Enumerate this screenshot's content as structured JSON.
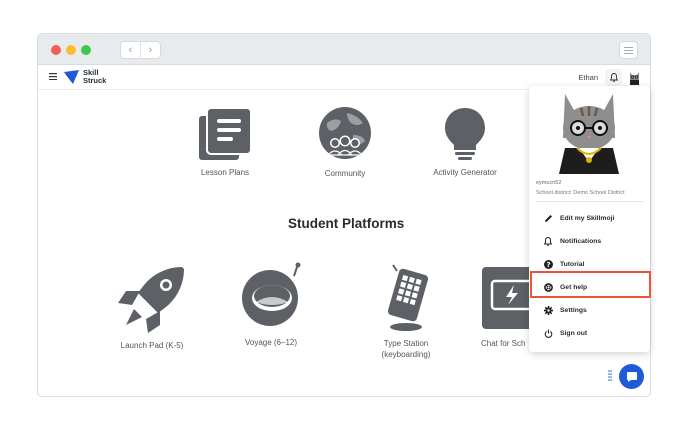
{
  "browser": {
    "back_glyph": "‹",
    "forward_glyph": "›"
  },
  "header": {
    "logo_line1": "Skill",
    "logo_line2": "Struck",
    "username": "Ethan"
  },
  "tiles_top": [
    {
      "label": "Lesson Plans",
      "icon": "book-icon"
    },
    {
      "label": "Community",
      "icon": "globe-people-icon"
    },
    {
      "label": "Activity Generator",
      "icon": "lightbulb-icon"
    }
  ],
  "section_title": "Student Platforms",
  "tiles_bottom": [
    {
      "label": "Launch Pad (K-5)",
      "icon": "rocket-icon"
    },
    {
      "label": "Voyage (6–12)",
      "icon": "helmet-icon"
    },
    {
      "label_line1": "Type Station",
      "label_line2": "(keyboarding)",
      "icon": "keyboard-icon"
    },
    {
      "label": "Chat for Sch",
      "icon": "chat-icon"
    }
  ],
  "dropdown": {
    "user_id": "eymucn52",
    "school": "School district: Demo School District",
    "items": [
      {
        "label": "Edit my Skillmoji",
        "icon": "pencil-icon"
      },
      {
        "label": "Notifications",
        "icon": "bell-icon"
      },
      {
        "label": "Tutorial",
        "icon": "question-icon"
      },
      {
        "label": "Get help",
        "icon": "lifebuoy-icon"
      },
      {
        "label": "Settings",
        "icon": "gear-icon"
      },
      {
        "label": "Sign out",
        "icon": "power-icon"
      }
    ]
  },
  "colors": {
    "accent": "#1f5bd8",
    "highlight": "#f0523a",
    "icon_gray": "#5d6166"
  }
}
